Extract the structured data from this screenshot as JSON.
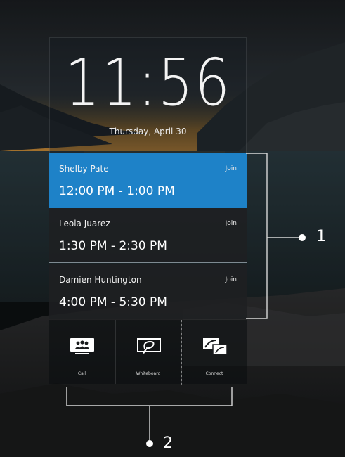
{
  "lock_screen": {
    "time": "11:56",
    "date": "Thursday, April 30"
  },
  "meetings": [
    {
      "organizer": "Shelby Pate",
      "join_label": "Join",
      "time_range": "12:00 PM - 1:00 PM",
      "selected": true
    },
    {
      "organizer": "Leola Juarez",
      "join_label": "Join",
      "time_range": "1:30 PM - 2:30 PM",
      "selected": false
    },
    {
      "organizer": "Damien Huntington",
      "join_label": "Join",
      "time_range": "4:00 PM - 5:30 PM",
      "selected": false
    }
  ],
  "actions": [
    {
      "label": "Call",
      "icon": "people-call-icon"
    },
    {
      "label": "Whiteboard",
      "icon": "whiteboard-pen-icon"
    },
    {
      "label": "Connect",
      "icon": "screen-connect-icon"
    }
  ],
  "callouts": [
    {
      "number": "1"
    },
    {
      "number": "2"
    }
  ],
  "colors": {
    "accent": "#1e82c8",
    "tile": "#1e2022",
    "divider": "#7f8a92"
  }
}
